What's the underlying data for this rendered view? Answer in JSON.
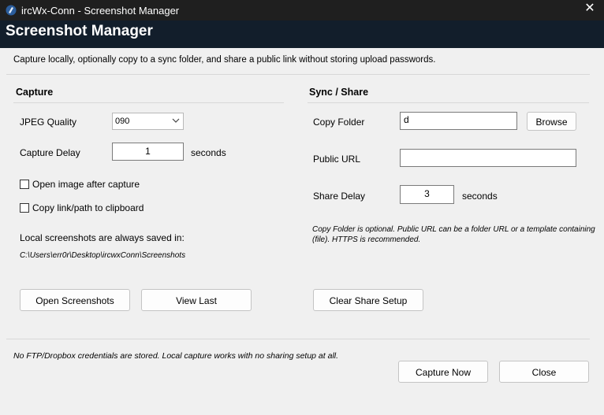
{
  "window": {
    "title": "ircWx-Conn - Screenshot Manager",
    "close_glyph": "✕"
  },
  "header": {
    "title": "Screenshot Manager"
  },
  "description": "Capture locally, optionally copy to a sync folder, and share a public link without storing upload passwords.",
  "capture": {
    "section_title": "Capture",
    "jpeg_quality_label": "JPEG Quality",
    "jpeg_quality_value": "090",
    "capture_delay_label": "Capture Delay",
    "capture_delay_value": "1",
    "capture_delay_unit": "seconds",
    "open_after_capture_label": "Open image after capture",
    "open_after_capture_checked": false,
    "copy_to_clipboard_label": "Copy link/path to clipboard",
    "copy_to_clipboard_checked": false,
    "local_saved_label": "Local screenshots are always saved in:",
    "local_path": "C:\\Users\\err0r\\Desktop\\ircwxConn\\Screenshots",
    "open_screenshots_button": "Open Screenshots",
    "view_last_button": "View Last"
  },
  "sync": {
    "section_title": "Sync / Share",
    "copy_folder_label": "Copy Folder",
    "copy_folder_value": "d",
    "browse_button": "Browse",
    "public_url_label": "Public URL",
    "public_url_value": "",
    "share_delay_label": "Share Delay",
    "share_delay_value": "3",
    "share_delay_unit": "seconds",
    "note": "Copy Folder is optional. Public URL can be a folder URL or a template containing (file). HTTPS is recommended.",
    "clear_share_button": "Clear Share Setup"
  },
  "footer": {
    "note": "No FTP/Dropbox credentials are stored. Local capture works with no sharing setup at all.",
    "capture_now_button": "Capture Now",
    "close_button": "Close"
  },
  "colors": {
    "titlebar": "#1f1f1f",
    "header": "#121e2b",
    "background": "#f0f0f0"
  }
}
